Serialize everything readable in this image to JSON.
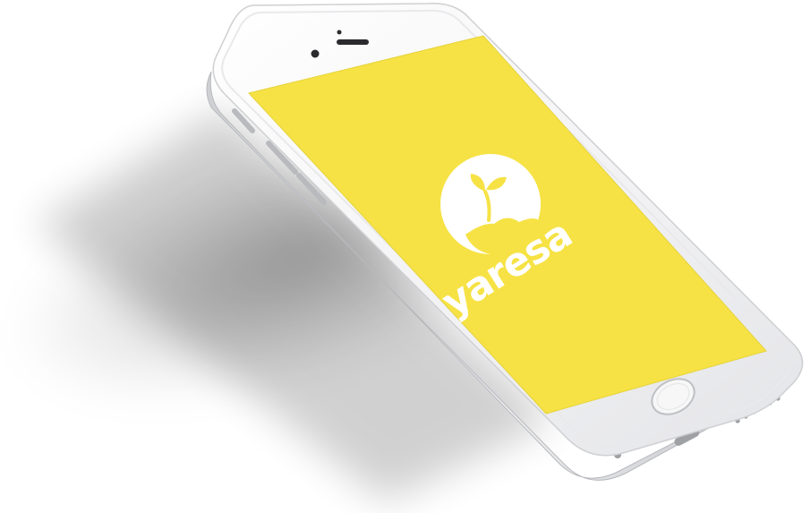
{
  "app": {
    "name": "yaresa",
    "splash_background": "#F6E244",
    "logo_color": "#FFFFFF"
  },
  "device": {
    "model": "smartphone",
    "body_color": "#F4F4F6",
    "frame_color": "#D9DADD"
  },
  "icons": {
    "logo": "sprout-in-circle-icon",
    "home_button": "home-button-icon",
    "camera": "front-camera-icon",
    "speaker": "earpiece-speaker-icon"
  }
}
